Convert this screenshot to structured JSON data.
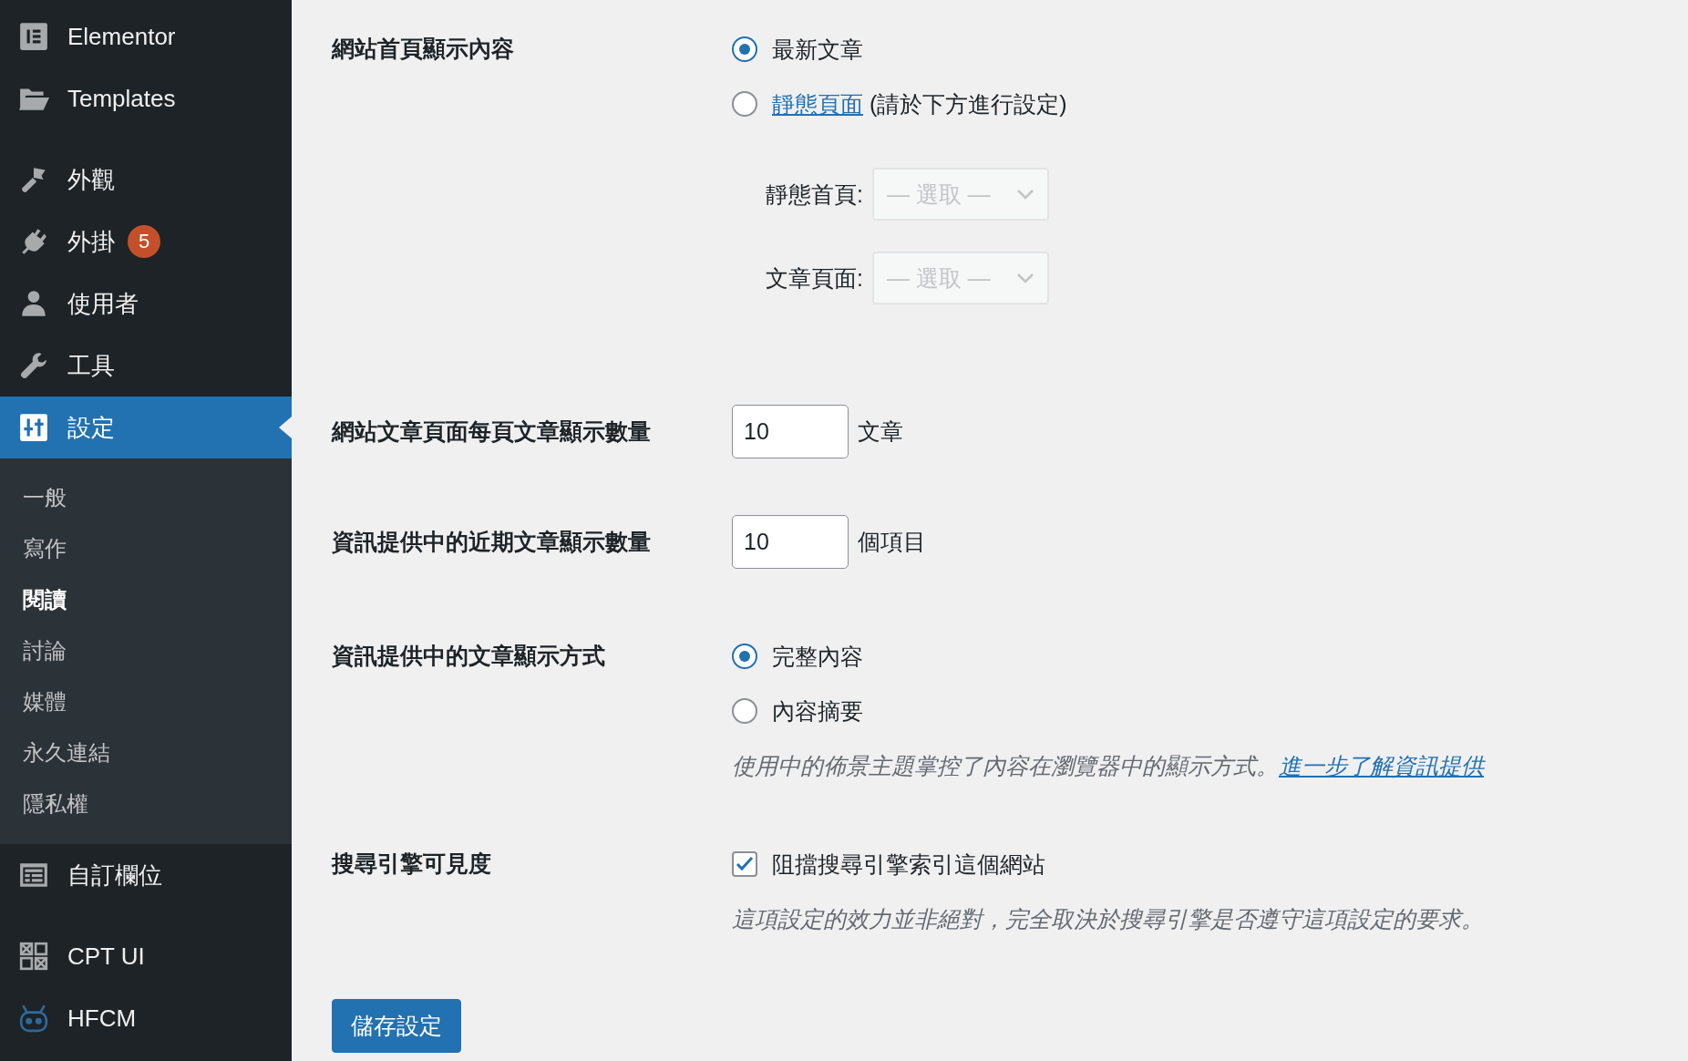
{
  "sidebar": {
    "items": [
      {
        "kind": "item",
        "label": "Elementor",
        "selected": false
      },
      {
        "kind": "item",
        "label": "Templates",
        "selected": false
      },
      {
        "kind": "separator"
      },
      {
        "kind": "item",
        "label": "外觀",
        "selected": false
      },
      {
        "kind": "item",
        "label": "外掛",
        "badge": "5",
        "selected": false
      },
      {
        "kind": "item",
        "label": "使用者",
        "selected": false
      },
      {
        "kind": "item",
        "label": "工具",
        "selected": false
      },
      {
        "kind": "item",
        "label": "設定",
        "selected": true,
        "children": [
          {
            "label": "一般",
            "selected": false
          },
          {
            "label": "寫作",
            "selected": false
          },
          {
            "label": "閱讀",
            "selected": true
          },
          {
            "label": "討論",
            "selected": false
          },
          {
            "label": "媒體",
            "selected": false
          },
          {
            "label": "永久連結",
            "selected": false
          },
          {
            "label": "隱私權",
            "selected": false
          }
        ]
      },
      {
        "kind": "item",
        "label": "自訂欄位",
        "selected": false
      },
      {
        "kind": "separator"
      },
      {
        "kind": "item",
        "label": "CPT UI",
        "selected": false
      },
      {
        "kind": "item",
        "label": "HFCM",
        "selected": false
      }
    ]
  },
  "settings": [
    {
      "kind": "radio-group",
      "label": "網站首頁顯示內容",
      "options": [
        {
          "label": "最新文章",
          "selected": true
        },
        {
          "link": "靜態頁面",
          "label": "(請於下方進行設定)",
          "selected": false
        }
      ],
      "selects": [
        {
          "label": "靜態首頁:",
          "value": "— 選取 —",
          "disabled": true
        },
        {
          "label": "文章頁面:",
          "value": "— 選取 —",
          "disabled": true
        }
      ]
    },
    {
      "kind": "number",
      "label": "網站文章頁面每頁文章顯示數量",
      "value": "10",
      "unit": "文章"
    },
    {
      "kind": "number",
      "label": "資訊提供中的近期文章顯示數量",
      "value": "10",
      "unit": "個項目"
    },
    {
      "kind": "radio-group",
      "label": "資訊提供中的文章顯示方式",
      "options": [
        {
          "label": "完整內容",
          "selected": true
        },
        {
          "label": "內容摘要",
          "selected": false
        }
      ],
      "description": "使用中的佈景主題掌控了內容在瀏覽器中的顯示方式。",
      "description_link": "進一步了解資訊提供"
    },
    {
      "kind": "checkbox",
      "label": "搜尋引擎可見度",
      "checkbox": {
        "label": "阻擋搜尋引擎索引這個網站",
        "checked": true
      },
      "description": "這項設定的效力並非絕對，完全取決於搜尋引擎是否遵守這項設定的要求。"
    }
  ],
  "save_button": "儲存設定"
}
